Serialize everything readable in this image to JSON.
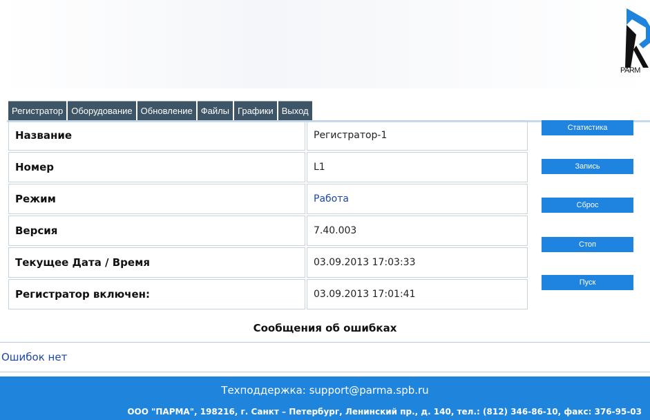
{
  "logo": {
    "text": "PARM"
  },
  "tabs": [
    "Регистратор",
    "Оборудование",
    "Обновление",
    "Файлы",
    "Графики",
    "Выход"
  ],
  "info": {
    "rows": [
      {
        "label": "Название",
        "value": "Регистратор-1"
      },
      {
        "label": "Номер",
        "value": "L1"
      },
      {
        "label": "Режим",
        "value": "Работа"
      },
      {
        "label": "Версия",
        "value": "7.40.003"
      },
      {
        "label": "Текущее Дата / Время",
        "value": "03.09.2013 17:03:33"
      },
      {
        "label": "Регистратор включен:",
        "value": "03.09.2013 17:01:41"
      }
    ]
  },
  "buttons": {
    "stats": "Статистика",
    "record": "Запись",
    "reset": "Сброс",
    "stop": "Стоп",
    "start": "Пуск"
  },
  "errors": {
    "title": "Сообщения об ошибках",
    "message": "Ошибок нет"
  },
  "footer": {
    "support": "Техподдержка: support@parma.spb.ru",
    "company": "ООО \"ПАРМА\", 198216, г. Санкт – Петербург, Ленинский пр., д. 140, тел.: (812) 346-86-10, факс: 376-95-03"
  },
  "colors": {
    "tab_bg": "#3d5566",
    "button_bg": "#1f83e0",
    "footer_bg": "#1e84dc",
    "link": "#1b47a6"
  }
}
